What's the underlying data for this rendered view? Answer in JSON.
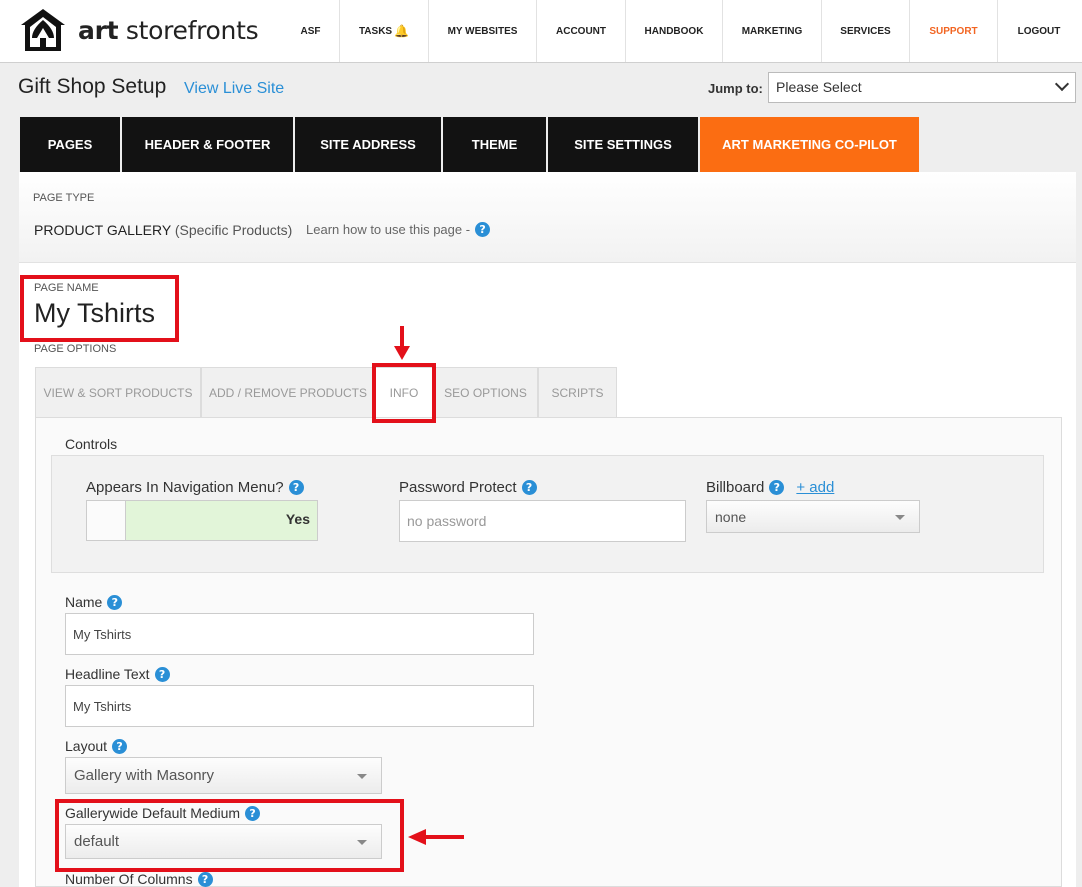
{
  "brand": {
    "name_bold": "art",
    "name_rest": " storefronts"
  },
  "nav": {
    "items": [
      {
        "label": "ASF"
      },
      {
        "label": "TASKS"
      },
      {
        "label": "MY WEBSITES"
      },
      {
        "label": "ACCOUNT"
      },
      {
        "label": "HANDBOOK"
      },
      {
        "label": "MARKETING"
      },
      {
        "label": "SERVICES"
      },
      {
        "label": "SUPPORT"
      },
      {
        "label": "LOGOUT"
      }
    ],
    "tasks_icon": "bell-icon",
    "support_color": "#f26522"
  },
  "header": {
    "title": "Gift Shop Setup",
    "view_live": "View Live Site",
    "jump_label": "Jump to:",
    "jump_value": "Please Select"
  },
  "main_tabs": [
    {
      "label": "PAGES"
    },
    {
      "label": "HEADER & FOOTER"
    },
    {
      "label": "SITE ADDRESS"
    },
    {
      "label": "THEME"
    },
    {
      "label": "SITE SETTINGS"
    },
    {
      "label": "ART MARKETING CO-PILOT"
    }
  ],
  "accent_color": "#fb6d12",
  "page_type": {
    "label": "PAGE TYPE",
    "value": "PRODUCT GALLERY",
    "sub": "(Specific Products)",
    "learn": "Learn how to use this page -"
  },
  "page_name": {
    "label": "PAGE NAME",
    "value": "My Tshirts"
  },
  "page_options": {
    "label": "PAGE OPTIONS",
    "tabs": [
      {
        "label": "VIEW & SORT PRODUCTS"
      },
      {
        "label": "ADD / REMOVE PRODUCTS"
      },
      {
        "label": "INFO"
      },
      {
        "label": "SEO OPTIONS"
      },
      {
        "label": "SCRIPTS"
      }
    ],
    "active_tab": "INFO"
  },
  "controls": {
    "title": "Controls",
    "nav_menu_label": "Appears In Navigation Menu?",
    "nav_menu_value": "Yes",
    "password_label": "Password Protect",
    "password_placeholder": "no password",
    "billboard_label": "Billboard",
    "billboard_add": "+ add",
    "billboard_value": "none"
  },
  "form": {
    "name_label": "Name",
    "name_value": "My Tshirts",
    "headline_label": "Headline Text",
    "headline_value": "My Tshirts",
    "layout_label": "Layout",
    "layout_value": "Gallery with Masonry",
    "medium_label": "Gallerywide Default Medium",
    "medium_value": "default",
    "columns_label": "Number Of Columns"
  },
  "annotation_color": "#e3101a"
}
